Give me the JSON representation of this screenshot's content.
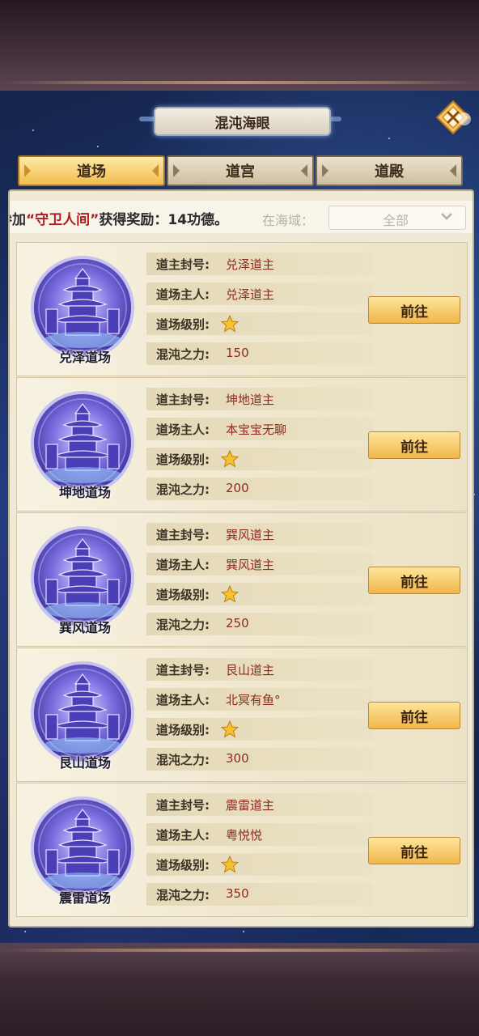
{
  "window": {
    "title": "混沌海眼"
  },
  "tabs": [
    {
      "label": "道场",
      "active": true
    },
    {
      "label": "道宫",
      "active": false
    },
    {
      "label": "道殿",
      "active": false
    }
  ],
  "notice": {
    "prefix": "参加",
    "event": "“守卫人间”",
    "suffix": "获得奖励：14功德。"
  },
  "filter": {
    "label": "在海域：",
    "selected": "全部"
  },
  "field_labels": {
    "title": "道主封号:",
    "owner": "道场主人:",
    "level": "道场级别:",
    "power": "混沌之力:"
  },
  "go_label": "前往",
  "cards": [
    {
      "name": "兑泽道场",
      "title": "兑泽道主",
      "owner": "兑泽道主",
      "level_stars": 1,
      "power": "150"
    },
    {
      "name": "坤地道场",
      "title": "坤地道主",
      "owner": "本宝宝无聊",
      "level_stars": 1,
      "power": "200"
    },
    {
      "name": "巽风道场",
      "title": "巽风道主",
      "owner": "巽风道主",
      "level_stars": 1,
      "power": "250"
    },
    {
      "name": "艮山道场",
      "title": "艮山道主",
      "owner": "北冥有鱼°",
      "level_stars": 1,
      "power": "300"
    },
    {
      "name": "震雷道场",
      "title": "震雷道主",
      "owner": "粤悦悦",
      "level_stars": 1,
      "power": "350"
    }
  ],
  "colors": {
    "accent_gold": "#f2bd4e",
    "value_red": "#8c2a1e",
    "highlight_red": "#b01c1c"
  }
}
